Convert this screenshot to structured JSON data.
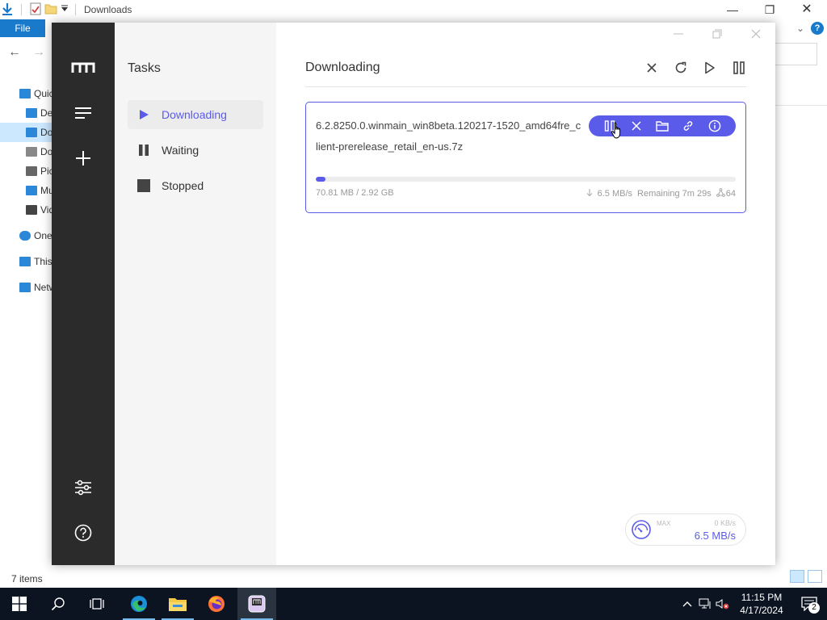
{
  "explorer": {
    "title": "Downloads",
    "file_tab": "File",
    "tree": [
      {
        "label": "Quick access",
        "icon": "star-icon",
        "indent": 0
      },
      {
        "label": "Desktop",
        "icon": "desktop-folder-icon",
        "indent": 1
      },
      {
        "label": "Downloads",
        "icon": "downloads-folder-icon",
        "indent": 1,
        "selected": true
      },
      {
        "label": "Documents",
        "icon": "documents-folder-icon",
        "indent": 1
      },
      {
        "label": "Pictures",
        "icon": "pictures-folder-icon",
        "indent": 1
      },
      {
        "label": "Music",
        "icon": "music-folder-icon",
        "indent": 1
      },
      {
        "label": "Videos",
        "icon": "videos-folder-icon",
        "indent": 1
      },
      {
        "label": "OneDrive",
        "icon": "cloud-icon",
        "indent": 0
      },
      {
        "label": "This PC",
        "icon": "computer-icon",
        "indent": 0
      },
      {
        "label": "Network",
        "icon": "network-icon",
        "indent": 0
      }
    ],
    "status": "7 items"
  },
  "motrix": {
    "subnav": {
      "title": "Tasks",
      "items": [
        {
          "label": "Downloading",
          "icon": "play-icon",
          "active": true
        },
        {
          "label": "Waiting",
          "icon": "pause-icon",
          "active": false
        },
        {
          "label": "Stopped",
          "icon": "stop-icon",
          "active": false
        }
      ]
    },
    "main": {
      "title": "Downloading"
    },
    "task": {
      "name": "6.2.8250.0.winmain_win8beta.120217-1520_amd64fre_client-prerelease_retail_en-us.7z",
      "progress": 0.024,
      "size": "70.81 MB / 2.92 GB",
      "speed": "6.5 MB/s",
      "remaining": "Remaining 7m 29s",
      "connections": "64"
    },
    "speedometer": {
      "max_label": "MAX",
      "upload": "0 KB/s",
      "download": "6.5 MB/s"
    }
  },
  "taskbar": {
    "time": "11:15 PM",
    "date": "4/17/2024",
    "notifications": "2"
  },
  "colors": {
    "accent": "#5b5bea",
    "aside": "#2b2b2b",
    "taskbar": "#0b1420"
  }
}
